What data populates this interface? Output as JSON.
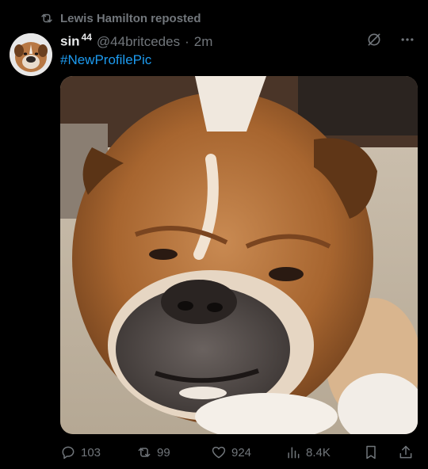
{
  "repost": {
    "icon": "repost-icon",
    "text": "Lewis Hamilton reposted"
  },
  "post": {
    "display_name": "sin",
    "superscript": "44",
    "handle": "@44britcedes",
    "separator": "·",
    "time": "2m",
    "text": "#NewProfilePic",
    "media_alt": "Close-up photo of a sleepy English bulldog lying on a carpet"
  },
  "top_icons": [
    "grok-icon",
    "more-icon"
  ],
  "actions": {
    "replies": "103",
    "reposts": "99",
    "likes": "924",
    "views": "8.4K"
  },
  "colors": {
    "background": "#000000",
    "text": "#e7e9ea",
    "muted": "#71767b",
    "link": "#1d9bf0"
  }
}
